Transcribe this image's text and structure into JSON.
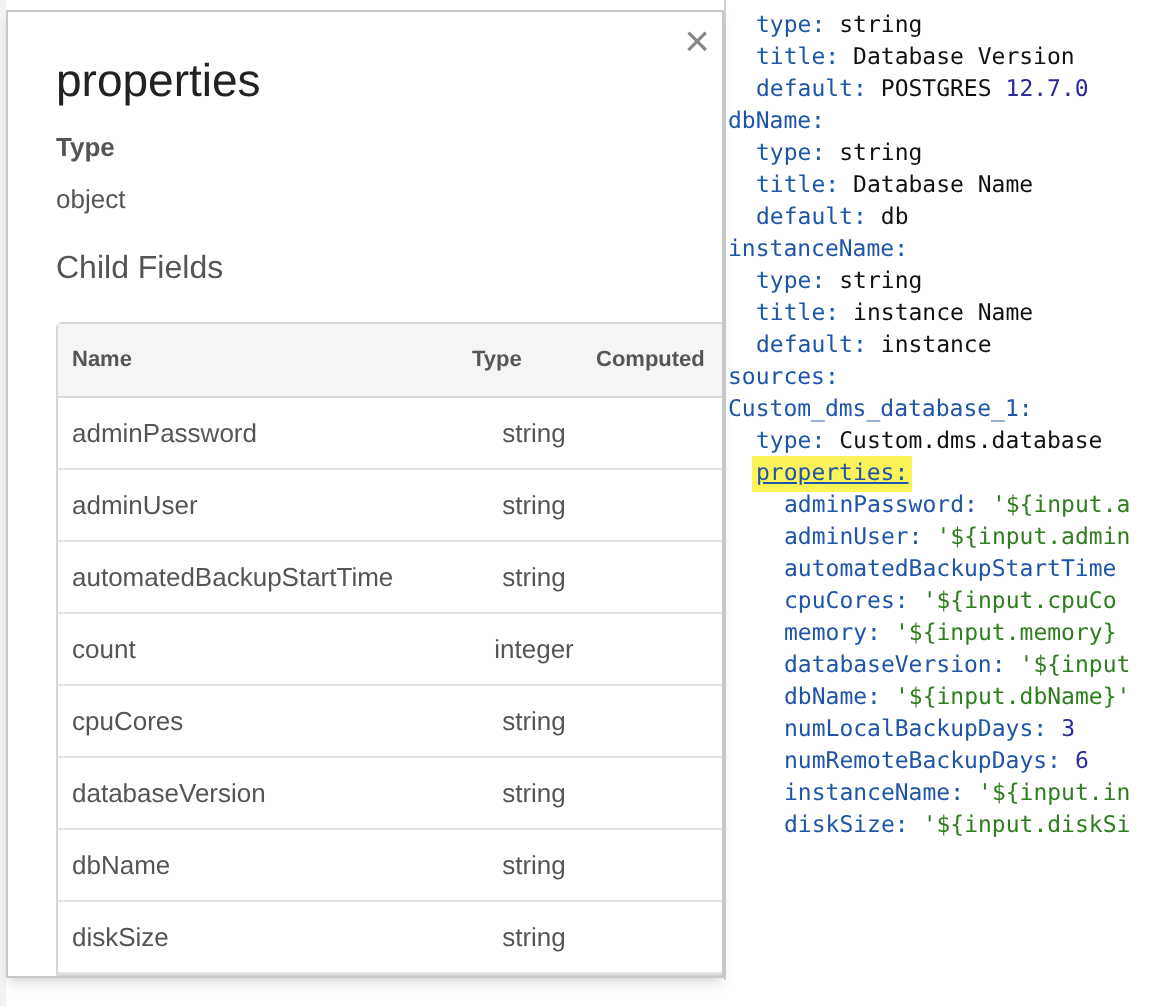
{
  "dialog": {
    "title": "properties",
    "close_icon": "×",
    "type_label": "Type",
    "type_value": "object",
    "section_title": "Child Fields",
    "table": {
      "columns": [
        "Name",
        "Type",
        "Computed"
      ],
      "rows": [
        {
          "name": "adminPassword",
          "type": "string"
        },
        {
          "name": "adminUser",
          "type": "string"
        },
        {
          "name": "automatedBackupStartTime",
          "type": "string"
        },
        {
          "name": "count",
          "type": "integer"
        },
        {
          "name": "cpuCores",
          "type": "string"
        },
        {
          "name": "databaseVersion",
          "type": "string"
        },
        {
          "name": "dbName",
          "type": "string"
        },
        {
          "name": "diskSize",
          "type": "string"
        }
      ]
    }
  },
  "code": [
    {
      "children": [
        {
          "key": "type:",
          "value": [
            {
              "text": "string",
              "kind": "plain"
            }
          ]
        },
        {
          "key": "title:",
          "value": [
            {
              "text": "Database Version",
              "kind": "plain"
            }
          ]
        },
        {
          "key": "default:",
          "value": [
            {
              "text": "POSTGRES",
              "kind": "plain"
            },
            {
              "text": "12.7.0",
              "kind": "number"
            }
          ]
        }
      ]
    },
    {
      "key": "dbName:",
      "children": [
        {
          "key": "type:",
          "value": [
            {
              "text": "string",
              "kind": "plain"
            }
          ]
        },
        {
          "key": "title:",
          "value": [
            {
              "text": "Database Name",
              "kind": "plain"
            }
          ]
        },
        {
          "key": "default:",
          "value": [
            {
              "text": "db",
              "kind": "plain"
            }
          ]
        }
      ]
    },
    {
      "key": "instanceName:",
      "children": [
        {
          "key": "type:",
          "value": [
            {
              "text": "string",
              "kind": "plain"
            }
          ]
        },
        {
          "key": "title:",
          "value": [
            {
              "text": "instance Name",
              "kind": "plain"
            }
          ]
        },
        {
          "key": "default:",
          "value": [
            {
              "text": "instance",
              "kind": "plain"
            }
          ]
        }
      ]
    },
    {
      "key": "sources:"
    },
    {
      "key": "Custom_dms_database_1:",
      "children": [
        {
          "key": "type:",
          "value": [
            {
              "text": "Custom.dms.database",
              "kind": "plain"
            }
          ]
        },
        {
          "key": "properties:",
          "highlighted": true,
          "children": [
            {
              "key": "adminPassword:",
              "value": [
                {
                  "text": "'${input.a",
                  "kind": "string"
                }
              ]
            },
            {
              "key": "adminUser:",
              "value": [
                {
                  "text": "'${input.admin",
                  "kind": "string"
                }
              ]
            },
            {
              "key": "automatedBackupStartTime"
            },
            {
              "key": "cpuCores:",
              "value": [
                {
                  "text": "'${input.cpuCo",
                  "kind": "string"
                }
              ]
            },
            {
              "key": "memory:",
              "value": [
                {
                  "text": "'${input.memory}",
                  "kind": "string"
                }
              ]
            },
            {
              "key": "databaseVersion:",
              "value": [
                {
                  "text": "'${input",
                  "kind": "string"
                }
              ]
            },
            {
              "key": "dbName:",
              "value": [
                {
                  "text": "'${input.dbName}'",
                  "kind": "string"
                }
              ]
            },
            {
              "key": "numLocalBackupDays:",
              "value": [
                {
                  "text": "3",
                  "kind": "number"
                }
              ]
            },
            {
              "key": "numRemoteBackupDays:",
              "value": [
                {
                  "text": "6",
                  "kind": "number"
                }
              ]
            },
            {
              "key": "instanceName:",
              "value": [
                {
                  "text": "'${input.in",
                  "kind": "string"
                }
              ]
            },
            {
              "key": "diskSize:",
              "value": [
                {
                  "text": "'${input.diskSi",
                  "kind": "string"
                }
              ]
            }
          ]
        }
      ]
    }
  ]
}
